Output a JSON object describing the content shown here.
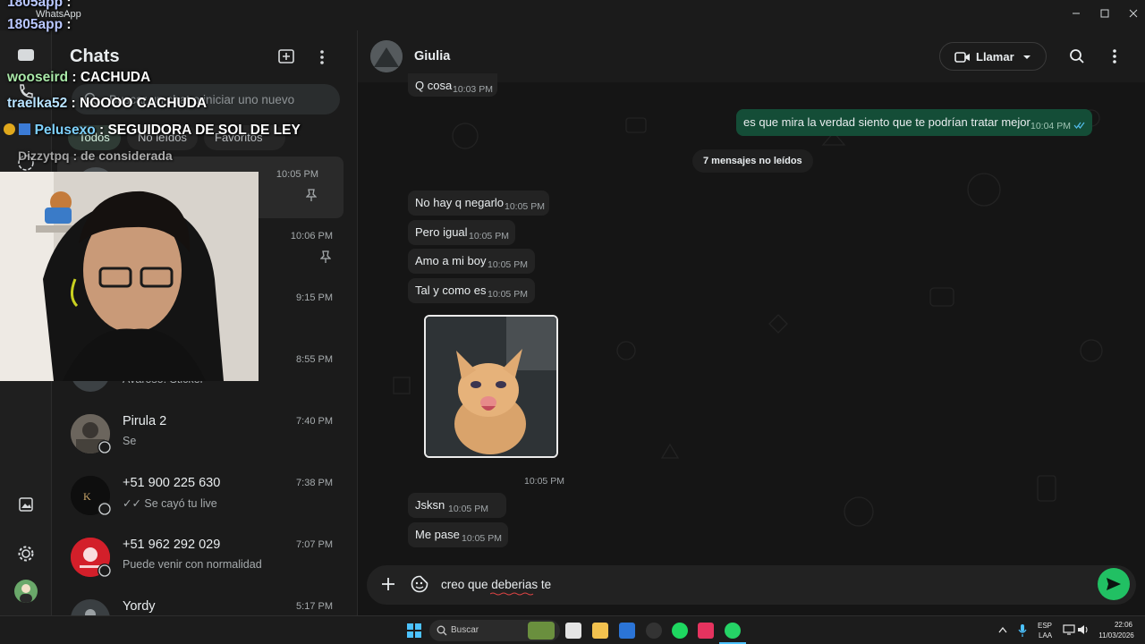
{
  "window": {
    "title": "WhatsApp"
  },
  "sidebar": {
    "title": "Chats"
  },
  "search": {
    "placeholder": "Buscar un chat o iniciar uno nuevo"
  },
  "filters": [
    "Todos",
    "No leídos",
    "Favoritos"
  ],
  "chats": [
    {
      "name": "",
      "last": "",
      "time": "10:05 PM",
      "pinned": true
    },
    {
      "name": "",
      "last": "",
      "time": "10:06 PM",
      "pinned": true
    },
    {
      "name": "",
      "last": "",
      "time": "9:15 PM"
    },
    {
      "name": "",
      "last": "Avaroso: Sticker",
      "time": "8:55 PM"
    },
    {
      "name": "Pirula 2",
      "last": "Se",
      "time": "7:40 PM"
    },
    {
      "name": "+51 900 225 630",
      "last": "✓✓ Se cayó tu live",
      "time": "7:38 PM"
    },
    {
      "name": "+51 962 292 029",
      "last": "Puede venir con normalidad",
      "time": "7:07 PM"
    },
    {
      "name": "Yordy",
      "last": "",
      "time": "5:17 PM"
    }
  ],
  "conversation": {
    "contact": "Giulia",
    "call_label": "Llamar",
    "unread_label": "7 mensajes no leídos",
    "messages": [
      {
        "text": "Q cosa",
        "time": "10:03 PM",
        "dir": "in"
      },
      {
        "text": "es que mira la verdad siento que te podrían tratar mejor",
        "time": "10:04 PM",
        "dir": "out"
      },
      {
        "text": "No hay q negarlo",
        "time": "10:05 PM",
        "dir": "in"
      },
      {
        "text": "Pero igual",
        "time": "10:05 PM",
        "dir": "in"
      },
      {
        "text": "Amo a mi boy",
        "time": "10:05 PM",
        "dir": "in"
      },
      {
        "text": "Tal y como es",
        "time": "10:05 PM",
        "dir": "in"
      },
      {
        "text": "Jsksn",
        "time": "10:05 PM",
        "dir": "in"
      },
      {
        "text": "Me pase",
        "time": "10:05 PM",
        "dir": "in"
      }
    ],
    "image_time": "10:05 PM",
    "composer_text": "creo que deberias te"
  },
  "stream_chat": [
    {
      "user": "1805app",
      "msg": ":"
    },
    {
      "user": "1805app",
      "msg": ":"
    },
    {
      "user": "wooseird",
      "msg": ": CACHUDA"
    },
    {
      "user": "traelka52",
      "msg": ": NOOOO CACHUDA"
    },
    {
      "user": "Pelusexo",
      "msg": ": SEGUIDORA DE SOL DE LEY"
    },
    {
      "user": "Dizzytpq",
      "msg": ": de considerada"
    }
  ],
  "taskbar": {
    "search_label": "Buscar",
    "lang": "ESP",
    "lang_sub": "LAA",
    "time": "22:06",
    "date": "11/03/2026"
  },
  "colors": {
    "accent": "#21c063",
    "outgoing_bubble": "#144d37",
    "background": "#111b21"
  }
}
